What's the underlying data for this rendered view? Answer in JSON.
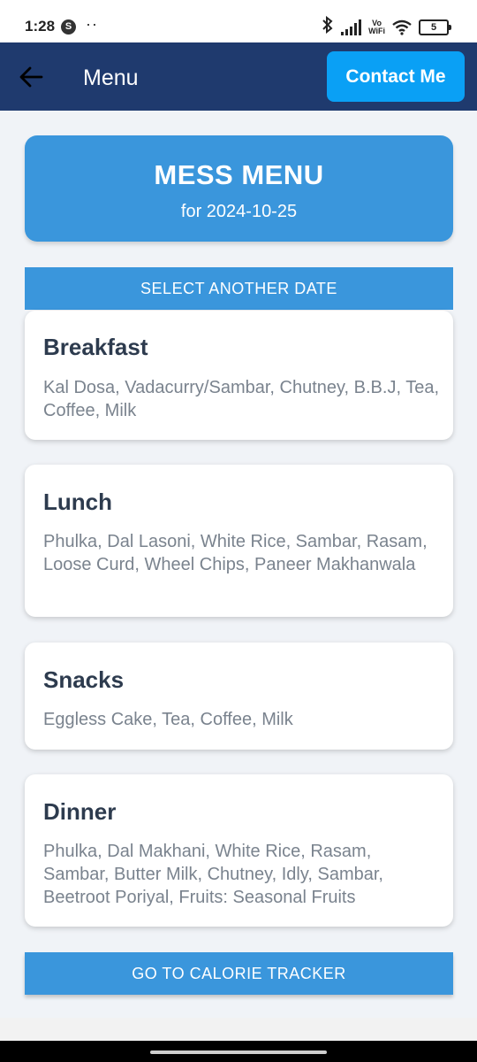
{
  "status_bar": {
    "time": "1:28",
    "notification_badge": "S",
    "dots": "··",
    "vowifi_top": "Vo",
    "vowifi_bottom": "WiFi",
    "battery": "5"
  },
  "app_bar": {
    "title": "Menu",
    "contact_label": "Contact Me",
    "color": "#1f3a6e",
    "contact_color": "#0aa0f5"
  },
  "header": {
    "title": "MESS MENU",
    "date_line": "for 2024-10-25",
    "color": "#3a96dc"
  },
  "select_date_label": "SELECT ANOTHER DATE",
  "meals": [
    {
      "title": "Breakfast",
      "items": "Kal Dosa, Vadacurry/Sambar, Chutney, B.B.J, Tea, Coffee, Milk"
    },
    {
      "title": "Lunch",
      "items": "Phulka, Dal Lasoni, White Rice, Sambar, Rasam, Loose Curd, Wheel Chips, Paneer Makhanwala"
    },
    {
      "title": "Snacks",
      "items": "Eggless Cake, Tea, Coffee, Milk"
    },
    {
      "title": "Dinner",
      "items": "Phulka, Dal Makhani, White Rice, Rasam, Sambar, Butter Milk, Chutney, Idly, Sambar, Beetroot Poriyal, Fruits: Seasonal Fruits"
    }
  ],
  "calorie_tracker_label": "GO TO CALORIE TRACKER"
}
